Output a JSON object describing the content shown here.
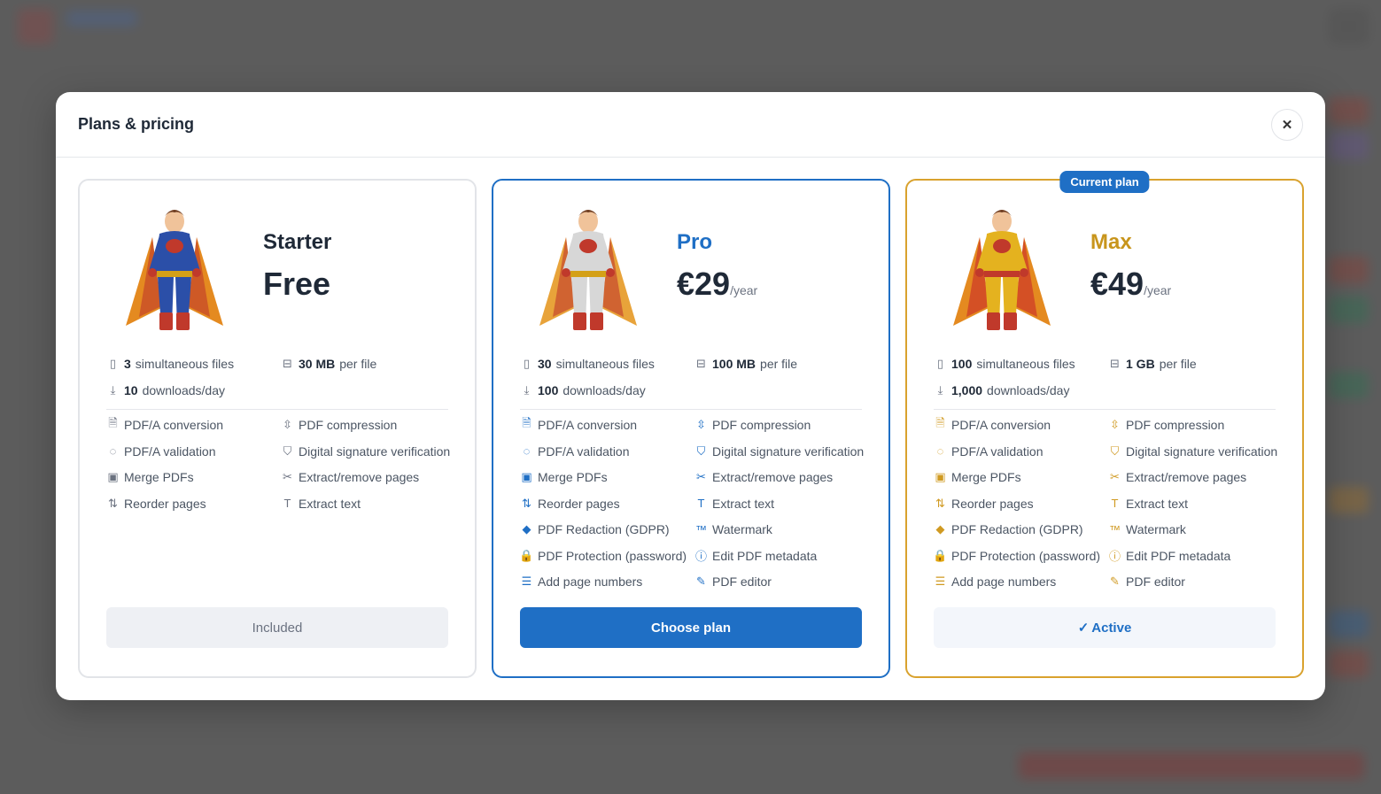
{
  "modal": {
    "title": "Plans & pricing"
  },
  "colors": {
    "accent": "#1f6fc5",
    "gold": "#d9a22e"
  },
  "plans": [
    {
      "name": "Starter",
      "price": "Free",
      "period": "",
      "limits": [
        {
          "icon": "file-icon",
          "value": "3",
          "text": "simultaneous files"
        },
        {
          "icon": "storage-icon",
          "value": "30 MB",
          "text": "per file"
        },
        {
          "icon": "download-icon",
          "value": "10",
          "text": "downloads/day"
        }
      ],
      "features": [
        {
          "icon": "pdfa-icon",
          "label": "PDF/A conversion"
        },
        {
          "icon": "compress-icon",
          "label": "PDF compression"
        },
        {
          "icon": "check-circle-icon",
          "label": "PDF/A validation"
        },
        {
          "icon": "shield-icon",
          "label": "Digital signature verification"
        },
        {
          "icon": "merge-icon",
          "label": "Merge PDFs"
        },
        {
          "icon": "scissors-icon",
          "label": "Extract/remove pages"
        },
        {
          "icon": "reorder-icon",
          "label": "Reorder pages"
        },
        {
          "icon": "text-icon",
          "label": "Extract text"
        }
      ],
      "cta": "Included"
    },
    {
      "name": "Pro",
      "price": "€29",
      "period": "/year",
      "limits": [
        {
          "icon": "file-icon",
          "value": "30",
          "text": "simultaneous files"
        },
        {
          "icon": "storage-icon",
          "value": "100 MB",
          "text": "per file"
        },
        {
          "icon": "download-icon",
          "value": "100",
          "text": "downloads/day"
        }
      ],
      "features": [
        {
          "icon": "pdfa-icon",
          "label": "PDF/A conversion"
        },
        {
          "icon": "compress-icon",
          "label": "PDF compression"
        },
        {
          "icon": "check-circle-icon",
          "label": "PDF/A validation"
        },
        {
          "icon": "shield-icon",
          "label": "Digital signature verification"
        },
        {
          "icon": "merge-icon",
          "label": "Merge PDFs"
        },
        {
          "icon": "scissors-icon",
          "label": "Extract/remove pages"
        },
        {
          "icon": "reorder-icon",
          "label": "Reorder pages"
        },
        {
          "icon": "text-icon",
          "label": "Extract text"
        },
        {
          "icon": "eraser-icon",
          "label": "PDF Redaction (GDPR)"
        },
        {
          "icon": "watermark-icon",
          "label": "Watermark"
        },
        {
          "icon": "lock-icon",
          "label": "PDF Protection (password)"
        },
        {
          "icon": "info-icon",
          "label": "Edit PDF metadata"
        },
        {
          "icon": "list-icon",
          "label": "Add page numbers"
        },
        {
          "icon": "edit-icon",
          "label": "PDF editor"
        }
      ],
      "cta": "Choose plan"
    },
    {
      "name": "Max",
      "price": "€49",
      "period": "/year",
      "badge": "Current plan",
      "limits": [
        {
          "icon": "file-icon",
          "value": "100",
          "text": "simultaneous files"
        },
        {
          "icon": "storage-icon",
          "value": "1 GB",
          "text": "per file"
        },
        {
          "icon": "download-icon",
          "value": "1,000",
          "text": "downloads/day"
        }
      ],
      "features": [
        {
          "icon": "pdfa-icon",
          "label": "PDF/A conversion"
        },
        {
          "icon": "compress-icon",
          "label": "PDF compression"
        },
        {
          "icon": "check-circle-icon",
          "label": "PDF/A validation"
        },
        {
          "icon": "shield-icon",
          "label": "Digital signature verification"
        },
        {
          "icon": "merge-icon",
          "label": "Merge PDFs"
        },
        {
          "icon": "scissors-icon",
          "label": "Extract/remove pages"
        },
        {
          "icon": "reorder-icon",
          "label": "Reorder pages"
        },
        {
          "icon": "text-icon",
          "label": "Extract text"
        },
        {
          "icon": "eraser-icon",
          "label": "PDF Redaction (GDPR)"
        },
        {
          "icon": "watermark-icon",
          "label": "Watermark"
        },
        {
          "icon": "lock-icon",
          "label": "PDF Protection (password)"
        },
        {
          "icon": "info-icon",
          "label": "Edit PDF metadata"
        },
        {
          "icon": "list-icon",
          "label": "Add page numbers"
        },
        {
          "icon": "edit-icon",
          "label": "PDF editor"
        }
      ],
      "cta": "Active"
    }
  ]
}
